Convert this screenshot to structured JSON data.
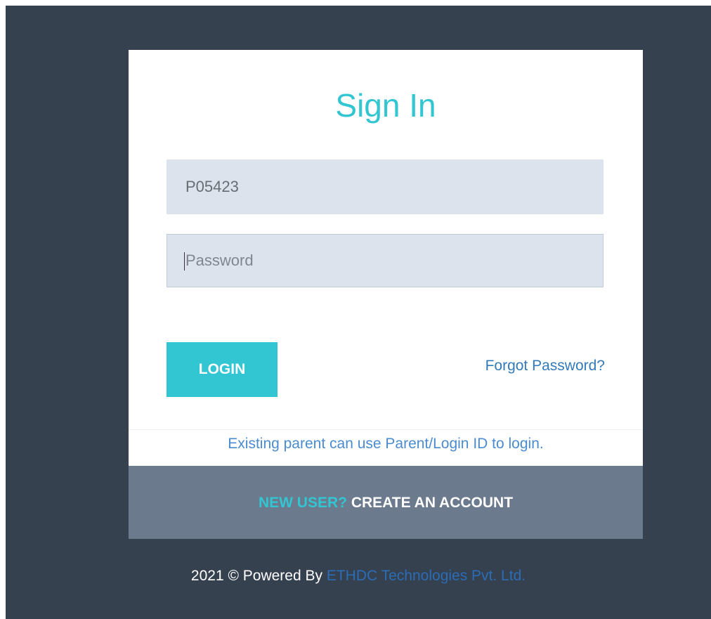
{
  "colors": {
    "page_background": "#364150",
    "accent": "#32c5d2",
    "link": "#337ab7",
    "signup_bar": "#6c7a8d"
  },
  "login": {
    "title": "Sign In",
    "username_value": "P05423",
    "password_placeholder": "Password",
    "login_button_label": "LOGIN",
    "forgot_password_label": "Forgot Password?",
    "note": "Existing parent can use Parent/Login ID to login."
  },
  "signup": {
    "question": "NEW USER?",
    "action": "CREATE AN ACCOUNT"
  },
  "footer": {
    "prefix": "2021 © Powered By",
    "company": "ETHDC Technologies Pvt. Ltd."
  }
}
